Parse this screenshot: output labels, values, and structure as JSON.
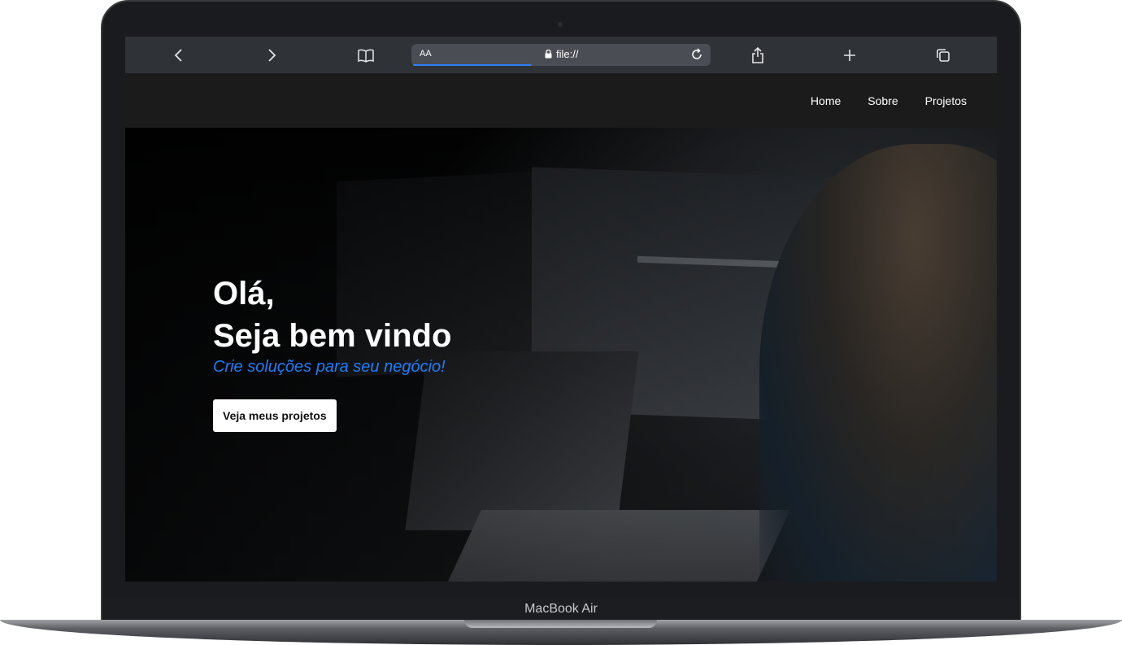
{
  "device": {
    "label": "MacBook Air"
  },
  "browser": {
    "text_size_label": "AA",
    "url": "file://",
    "icons": [
      "back-icon",
      "forward-icon",
      "bookmarks-icon",
      "lock-icon",
      "reload-icon",
      "share-icon",
      "new-tab-icon",
      "tabs-icon"
    ]
  },
  "nav": {
    "items": [
      {
        "label": "Home"
      },
      {
        "label": "Sobre"
      },
      {
        "label": "Projetos"
      }
    ]
  },
  "hero": {
    "greeting": "Olá,",
    "title": "Seja bem vindo",
    "subtitle": "Crie soluções para seu negócio!",
    "cta_label": "Veja meus projetos"
  },
  "colors": {
    "accent_blue": "#1e7dfa",
    "whatsapp_green": "#25b43a",
    "nav_bg": "#1b1b1b",
    "browser_bar": "#2f3237"
  }
}
